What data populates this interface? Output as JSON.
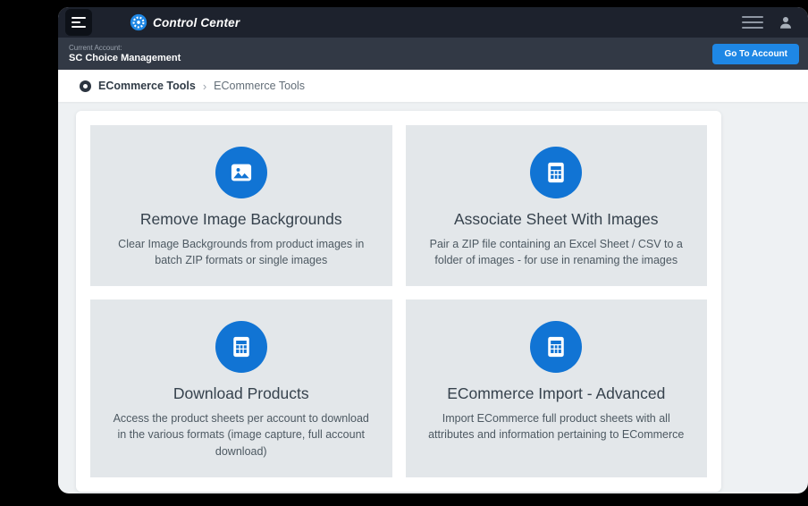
{
  "header": {
    "brand": "Control Center"
  },
  "account_bar": {
    "label": "Current Account:",
    "name": "SC Choice Management",
    "button": "Go To Account"
  },
  "breadcrumb": {
    "section": "ECommerce Tools",
    "chevron": "›",
    "page": "ECommerce Tools"
  },
  "tiles": [
    {
      "title": "Remove Image Backgrounds",
      "description": "Clear Image Backgrounds from product images in batch ZIP formats or single images",
      "icon": "image-icon"
    },
    {
      "title": "Associate Sheet With Images",
      "description": "Pair a ZIP file containing an Excel Sheet / CSV to a folder of images - for use in renaming the images",
      "icon": "sheet-icon"
    },
    {
      "title": "Download Products",
      "description": "Access the product sheets per account to download in the various formats (image capture, full account download)",
      "icon": "sheet-icon"
    },
    {
      "title": "ECommerce Import - Advanced",
      "description": "Import ECommerce full product sheets with all attributes and information pertaining to ECommerce",
      "icon": "sheet-icon"
    }
  ],
  "icons": {
    "menu_toggle": "hamburger",
    "brand_logo": "blue-gear-circle",
    "menu_lines": "three-lines",
    "user": "person-silhouette",
    "breadcrumb": "dark-dot-circle",
    "tile_image": "picture-in-circle",
    "tile_sheet": "spreadsheet-in-circle"
  },
  "colors": {
    "accent_blue": "#1174d4",
    "button_blue": "#1e87e5",
    "header_bg": "#1d222d",
    "account_bar_bg": "#323945",
    "tile_bg": "#e3e7ea",
    "content_bg": "#eef1f3"
  }
}
